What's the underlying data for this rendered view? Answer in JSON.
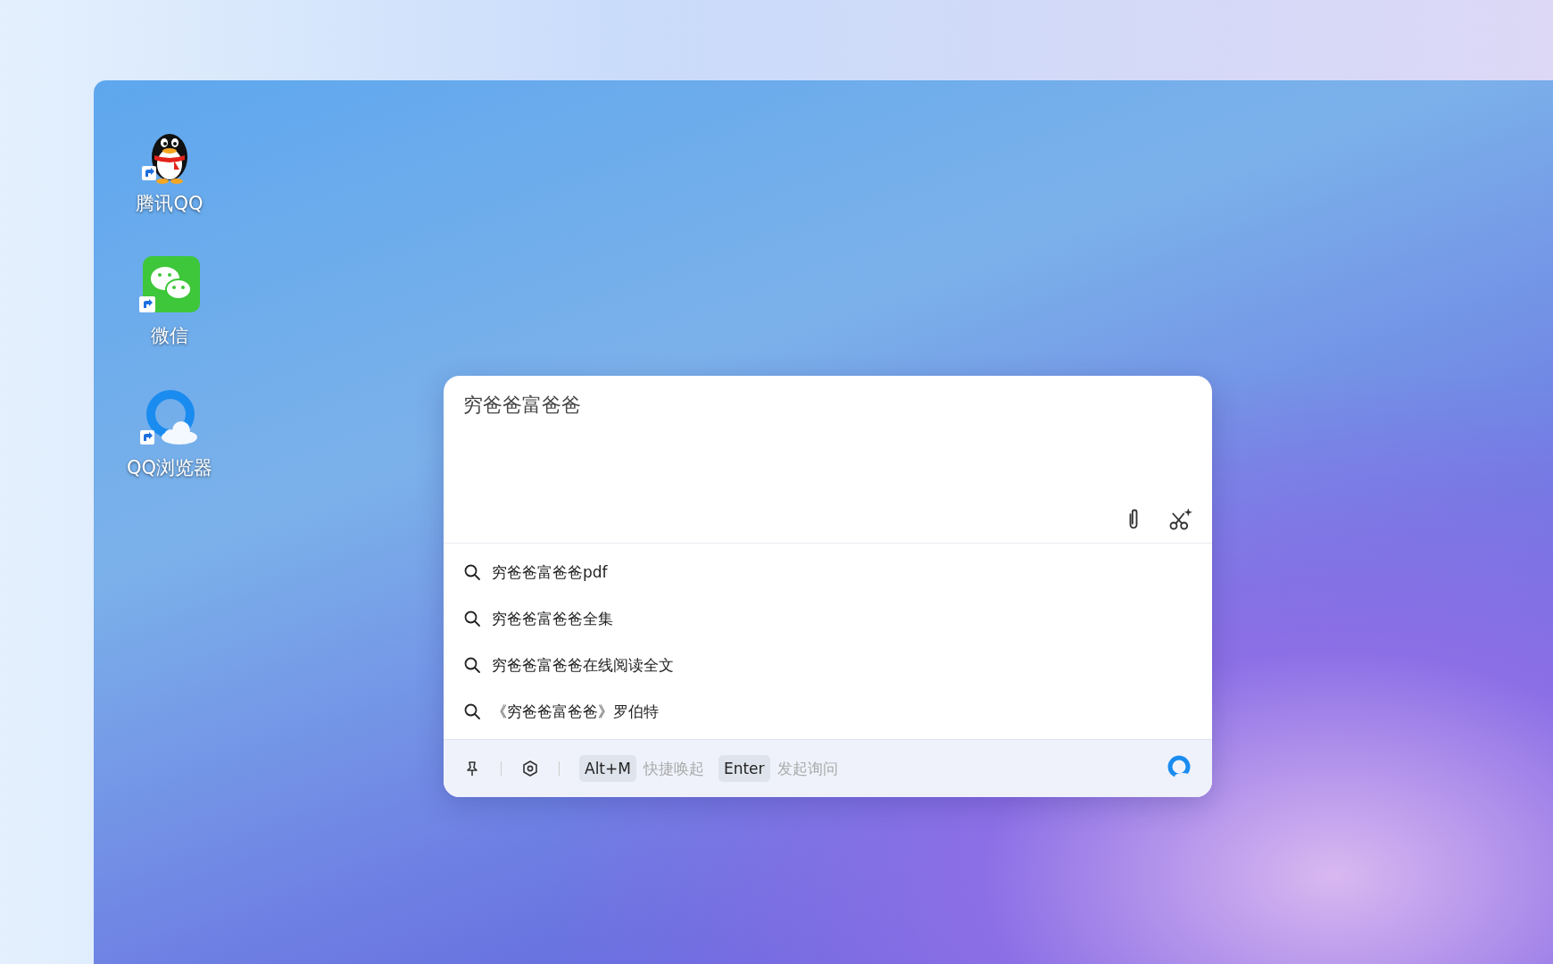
{
  "desktop_icons": [
    {
      "kind": "qq",
      "label": "腾讯QQ"
    },
    {
      "kind": "wechat",
      "label": "微信"
    },
    {
      "kind": "browser",
      "label": "QQ浏览器"
    }
  ],
  "search_dialog": {
    "query": "穷爸爸富爸爸",
    "suggestions": [
      {
        "text": "穷爸爸富爸爸pdf"
      },
      {
        "text": "穷爸爸富爸爸全集"
      },
      {
        "text": "穷爸爸富爸爸在线阅读全文"
      },
      {
        "text": "《穷爸爸富爸爸》罗伯特"
      }
    ],
    "shortcuts": [
      {
        "key": "Alt+M",
        "description": "快捷唤起"
      },
      {
        "key": "Enter",
        "description": "发起询问"
      }
    ]
  }
}
